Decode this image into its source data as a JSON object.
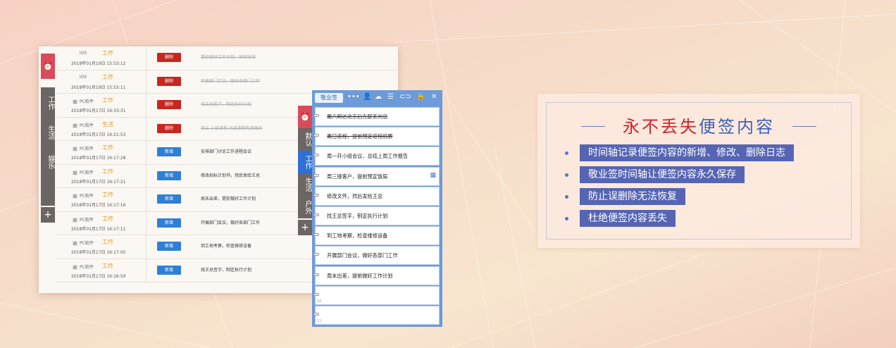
{
  "timeline": {
    "alarm_icon": "alarm-clock-icon",
    "categories": [
      "工作",
      "生活",
      "娱乐"
    ],
    "add_label": "+",
    "rows": [
      {
        "os": "iOS",
        "os_icon": "apple-icon",
        "time": "2018年01月19日 15:53:12",
        "category": "工作",
        "action": "删除",
        "action_type": "del",
        "text": "提前做好工作计划，审核安排",
        "strike": true
      },
      {
        "os": "iOS",
        "os_icon": "apple-icon",
        "time": "2018年01月19日 15:53:11",
        "category": "工作",
        "action": "删除",
        "action_type": "del",
        "text": "开展部门会议，做好各部门工作",
        "strike": true
      },
      {
        "os": "PC软件",
        "os_icon": "windows-icon",
        "time": "2018年01月17日 16:33:31",
        "category": "工作",
        "action": "删除",
        "action_type": "del",
        "text": "找王总签字，制定执行计划",
        "strike": true
      },
      {
        "os": "PC软件",
        "os_icon": "windows-icon",
        "time": "2018年01月17日 16:21:53",
        "category": "生活",
        "action": "删除",
        "action_type": "del",
        "text": "周三 小班课程 大班课程构思图片",
        "strike": true
      },
      {
        "os": "PC软件",
        "os_icon": "windows-icon",
        "time": "2018年01月17日 16:17:28",
        "category": "工作",
        "action": "新增",
        "action_type": "new",
        "text": "安排部门讨论工作进程会议",
        "strike": false
      },
      {
        "os": "PC软件",
        "os_icon": "windows-icon",
        "time": "2018年01月17日 16:17:21",
        "category": "工作",
        "action": "新增",
        "action_type": "new",
        "text": "修改招标计划书，然后发给王总",
        "strike": false
      },
      {
        "os": "PC软件",
        "os_icon": "windows-icon",
        "time": "2018年01月17日 16:17:16",
        "category": "工作",
        "action": "新增",
        "action_type": "new",
        "text": "周末出差，提前做好工作计划",
        "strike": false
      },
      {
        "os": "PC软件",
        "os_icon": "windows-icon",
        "time": "2018年01月17日 16:17:11",
        "category": "工作",
        "action": "新增",
        "action_type": "new",
        "text": "开展部门会议，做好各部门工作",
        "strike": false
      },
      {
        "os": "PC软件",
        "os_icon": "windows-icon",
        "time": "2018年01月17日 16:17:05",
        "category": "工作",
        "action": "新增",
        "action_type": "new",
        "text": "到工地考察，检查维修设备",
        "strike": false
      },
      {
        "os": "PC软件",
        "os_icon": "windows-icon",
        "time": "2018年01月17日 16:16:59",
        "category": "工作",
        "action": "新增",
        "action_type": "new",
        "text": "找王总签字，制定执行计划",
        "strike": false
      }
    ]
  },
  "sticky": {
    "tab_label": "敬业签",
    "toolbar_icons": [
      "more-icon",
      "user-icon",
      "cloud-icon",
      "list-icon",
      "toggle-icon",
      "lock-icon",
      "close-icon"
    ],
    "categories": [
      "默认",
      "工作",
      "生活",
      "户外"
    ],
    "active_category": "工作",
    "add_label": "+",
    "items": [
      {
        "num": "",
        "text": "周六到达北京后先联系刘总",
        "strike": true
      },
      {
        "num": "",
        "text": "周日返程，提前预定返程机票",
        "strike": true
      },
      {
        "num": "",
        "text": "周一开小组会议，总结上周工作报告",
        "strike": false
      },
      {
        "num": "",
        "text": "周三接客户，提前预定饭局",
        "strike": false
      },
      {
        "num": "",
        "text": "修改文件，然后发给王总",
        "strike": false
      },
      {
        "num": "",
        "text": "找王总签字，制定执行计划",
        "strike": false
      },
      {
        "num": "",
        "text": "到工地考察，检查维修设备",
        "strike": false
      },
      {
        "num": "",
        "text": "开展部门会议，做好各部门工作",
        "strike": false
      },
      {
        "num": "",
        "text": "周末出差，提前做好工作计划",
        "strike": false
      },
      {
        "num": "10",
        "text": "",
        "strike": false
      },
      {
        "num": "11",
        "text": "",
        "strike": false
      }
    ]
  },
  "features": {
    "title_red": "永不丢失",
    "title_blue": "便签内容",
    "items": [
      "时间轴记录便签内容的新增、修改、删除日志",
      "敬业签时间轴让便签内容永久保存",
      "防止误删除无法恢复",
      "杜绝便签内容丢失"
    ]
  },
  "colors": {
    "accent_red": "#d3232a",
    "accent_blue": "#5665b3",
    "delete_badge": "#c8261e",
    "new_badge": "#2f7fd6",
    "sticky_blue": "#6e9bd8"
  }
}
